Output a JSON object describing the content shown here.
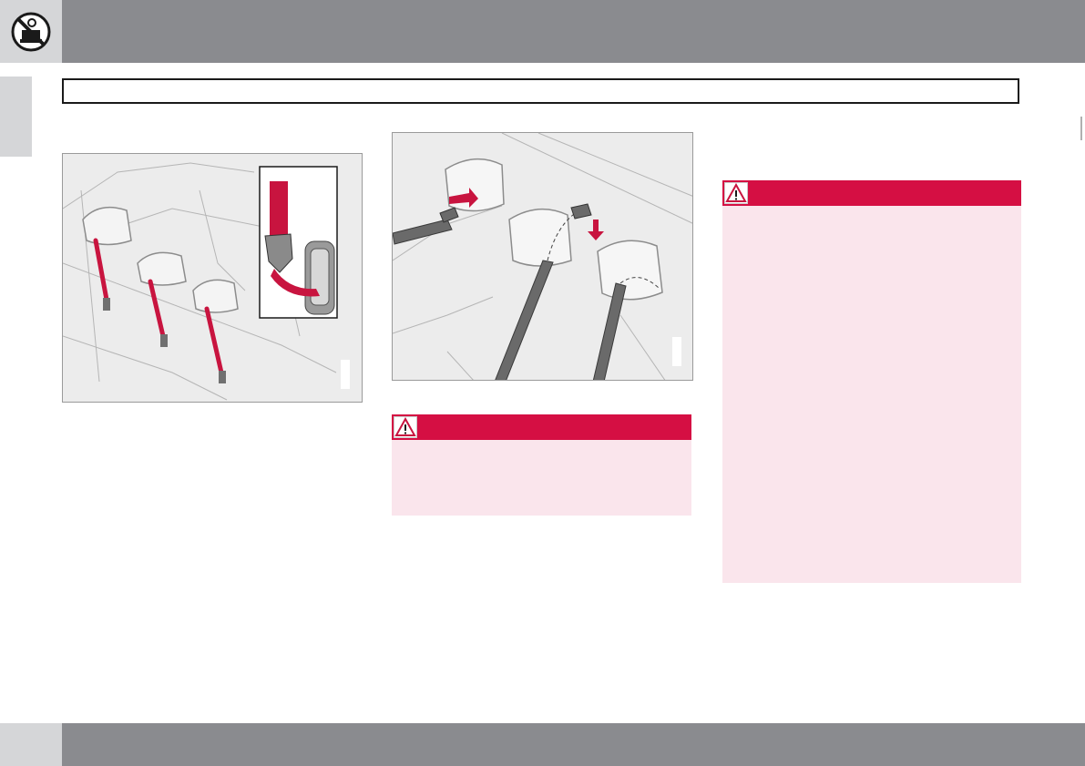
{
  "header": {
    "icon": "child-safety-seat-prohibited-icon",
    "chapter_title": ""
  },
  "figures": [
    {
      "icon": "rear-seat-belts-stowed-illustration",
      "code": ""
    },
    {
      "icon": "headrest-belt-routing-illustration",
      "code": ""
    }
  ],
  "warnings": [
    {
      "icon": "warning-triangle-icon",
      "heading": "",
      "text": ""
    },
    {
      "icon": "warning-triangle-icon",
      "heading": "",
      "text": ""
    }
  ],
  "footer": {
    "page_number": ""
  },
  "colors": {
    "accent_red": "#d50f43",
    "warning_body": "#fae5ec",
    "bar_gray": "#8a8b8f",
    "light_gray": "#d5d6d8"
  }
}
